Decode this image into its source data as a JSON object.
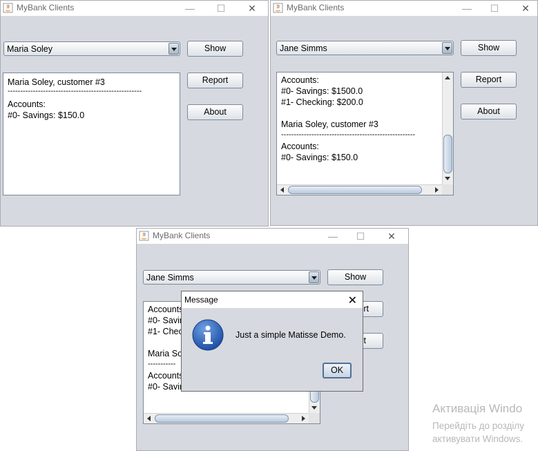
{
  "windows": [
    {
      "title": "MyBank Clients",
      "combo": "Maria Soley",
      "buttons": {
        "show": "Show",
        "report": "Report",
        "about": "About"
      },
      "text_lines": [
        "Maria Soley, customer #3",
        "-----------------------------------------------------",
        "Accounts:",
        "#0- Savings: $150.0"
      ]
    },
    {
      "title": "MyBank Clients",
      "combo": "Jane Simms",
      "buttons": {
        "show": "Show",
        "report": "Report",
        "about": "About"
      },
      "text_lines": [
        "Accounts:",
        "#0- Savings: $1500.0",
        "#1- Checking: $200.0",
        "",
        "Maria Soley, customer #3",
        "-----------------------------------------------------",
        "Accounts:",
        "#0- Savings: $150.0"
      ]
    },
    {
      "title": "MyBank Clients",
      "combo": "Jane Simms",
      "buttons": {
        "show": "Show",
        "report_partial": "rt",
        "about_partial": "t"
      },
      "text_lines": [
        "Accounts",
        "#0- Savin",
        "#1- Chec",
        "",
        "Maria Sol",
        "-----------",
        "Accounts",
        "#0- Savin"
      ]
    }
  ],
  "dialog": {
    "title": "Message",
    "message": "Just a simple Matisse Demo.",
    "ok": "OK",
    "icon": "info-icon"
  },
  "watermark": {
    "line1": "Активація Windo",
    "line2": "Перейдіть до розділу",
    "line3": "активувати Windows."
  },
  "colors": {
    "window_bg": "#d6d9df",
    "titlebar_bg": "#ffffff",
    "info_icon": "#2a5db0"
  }
}
